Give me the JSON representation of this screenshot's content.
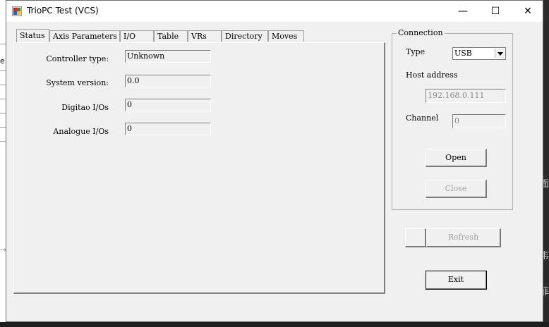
{
  "window": {
    "title": "TrioPC Test (VCS)",
    "min_glyph": "—",
    "max_glyph": "☐",
    "close_glyph": "✕"
  },
  "tabs": [
    {
      "label": "Status",
      "active": true
    },
    {
      "label": "Axis Parameters"
    },
    {
      "label": "I/O"
    },
    {
      "label": "Table"
    },
    {
      "label": "VRs"
    },
    {
      "label": "Directory"
    },
    {
      "label": "Moves"
    }
  ],
  "status": {
    "controller_type_label": "Controller type:",
    "controller_type_value": "Unknown",
    "system_version_label": "System version:",
    "system_version_value": "0.0",
    "digital_io_label": "Digitao I/Os",
    "digital_io_value": "0",
    "analogue_io_label": "Analogue I/Os",
    "analogue_io_value": "0"
  },
  "connection": {
    "group_title": "Connection",
    "type_label": "Type",
    "type_value": "USB",
    "host_label": "Host address",
    "host_value": "192.168.0.111",
    "channel_label": "Channel",
    "channel_value": "0",
    "open_label": "Open",
    "close_label": "Close"
  },
  "actions": {
    "refresh_label": "Refresh",
    "exit_label": "Exit"
  },
  "background": {
    "left_glyph": "e",
    "arrow_glyph": "→",
    "right_glyphs": [
      "面",
      "韦",
      "菲"
    ]
  }
}
